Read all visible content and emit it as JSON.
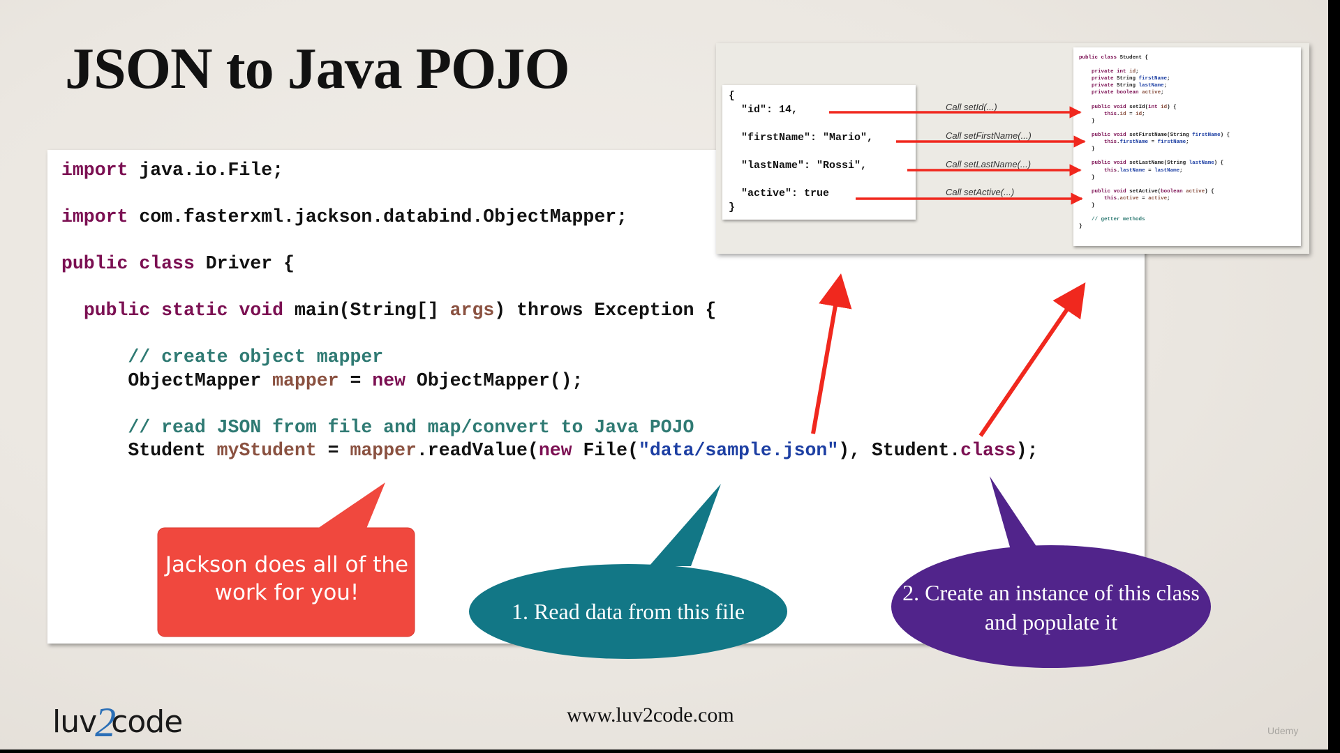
{
  "slide": {
    "title": "JSON to Java POJO",
    "url": "www.luv2code.com",
    "logo_left": "luv",
    "logo_mid": "2",
    "logo_right": "code",
    "watermark": "Udemy"
  },
  "code_lines": [
    "import java.io.File;",
    "",
    "import com.fasterxml.jackson.databind.ObjectMapper;",
    "",
    "public class Driver {",
    "",
    "  public static void main(String[] args) throws Exception {",
    "",
    "      // create object mapper",
    "      ObjectMapper mapper = new ObjectMapper();",
    "",
    "      // read JSON from file and map/convert to Java POJO",
    "      Student myStudent = mapper.readValue(new File(\"data/sample.json\"), Student.class);"
  ],
  "json_sample": [
    "{",
    "  \"id\": 14,",
    "",
    "  \"firstName\": \"Mario\",",
    "",
    "  \"lastName\": \"Rossi\",",
    "",
    "  \"active\": true",
    "}"
  ],
  "student_class": [
    "public class Student {",
    "",
    "    private int id;",
    "    private String firstName;",
    "    private String lastName;",
    "    private boolean active;",
    "",
    "    public void setId(int id) {",
    "        this.id = id;",
    "    }",
    "",
    "    public void setFirstName(String firstName) {",
    "        this.firstName = firstName;",
    "    }",
    "",
    "    public void setLastName(String lastName) {",
    "        this.lastName = lastName;",
    "    }",
    "",
    "    public void setActive(boolean active) {",
    "        this.active = active;",
    "    }",
    "",
    "    // getter methods",
    "}"
  ],
  "call_labels": [
    "Call setId(...)",
    "Call setFirstName(...)",
    "Call setLastName(...)",
    "Call setActive(...)"
  ],
  "bubbles": {
    "jackson": "Jackson does all of the work for you!",
    "read_file": "1. Read data from this file",
    "create_instance": "2. Create an instance of this class and populate it"
  },
  "colors": {
    "arrow_red": "#f0281e",
    "bubble_red": "#f0483e",
    "bubble_teal": "#127786",
    "bubble_purple": "#51248b",
    "keyword": "#7b0f52",
    "comment": "#2f7a73",
    "string": "#1d3fa3"
  }
}
